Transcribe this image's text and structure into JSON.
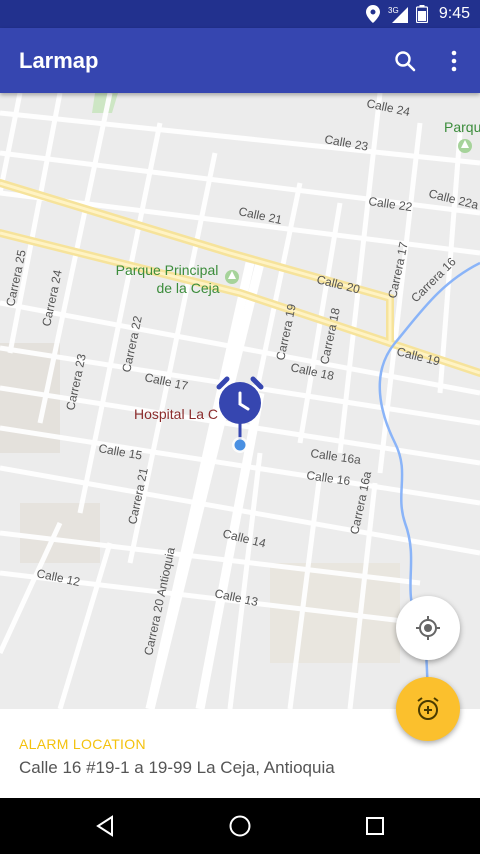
{
  "status_bar": {
    "time": "9:45",
    "network": "3G"
  },
  "app_bar": {
    "title": "Larmap"
  },
  "map": {
    "pois": {
      "park_line1": "Parque Principal",
      "park_line2": "de la Ceja",
      "hospital": "Hospital La C",
      "park_right": "Parqu"
    },
    "streets": {
      "calle_24": "Calle 24",
      "calle_23": "Calle 23",
      "calle_22": "Calle 22",
      "calle_22a": "Calle 22a",
      "calle_21": "Calle 21",
      "calle_20": "Calle 20",
      "calle_19": "Calle 19",
      "calle_18": "Calle 18",
      "calle_17": "Calle 17",
      "calle_16a": "Calle 16a",
      "calle_16": "Calle 16",
      "calle_15": "Calle 15",
      "calle_14": "Calle 14",
      "calle_13": "Calle 13",
      "calle_12": "Calle 12",
      "carrera_25": "Carrera 25",
      "carrera_24": "Carrera 24",
      "carrera_23": "Carrera 23",
      "carrera_22": "Carrera 22",
      "carrera_21": "Carrera 21",
      "carrera_20a": "Carrera 20 Antioquia",
      "carrera_19": "Carrera 19",
      "carrera_18": "Carrera 18",
      "carrera_17": "Carrera 17",
      "carrera_16": "Carrera 16",
      "carrera_16a": "Carrera 16a"
    }
  },
  "alarm_sheet": {
    "label": "ALARM LOCATION",
    "address": "Calle 16 #19-1 a 19-99 La Ceja, Antioquia"
  },
  "colors": {
    "primary": "#3646b0",
    "primary_dark": "#22318e",
    "accent": "#fbc02d",
    "marker": "#3646b0"
  }
}
